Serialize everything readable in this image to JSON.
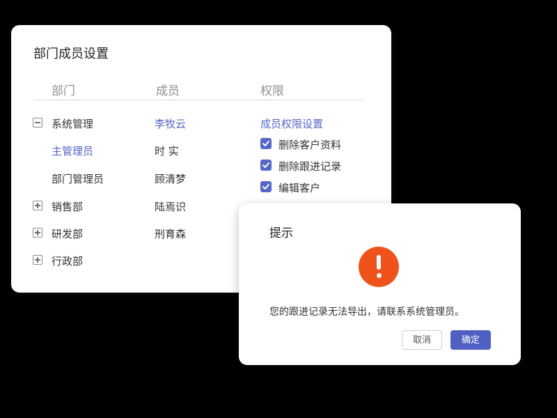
{
  "card": {
    "title": "部门成员设置",
    "columns": {
      "dept": "部门",
      "member": "成员",
      "permission": "权限"
    },
    "departments": [
      {
        "label": "系统管理",
        "toggle": "collapse"
      },
      {
        "label": "主管理员",
        "toggle": "none",
        "selected": true
      },
      {
        "label": "部门管理员",
        "toggle": "none"
      },
      {
        "label": "销售部",
        "toggle": "expand"
      },
      {
        "label": "研发部",
        "toggle": "expand"
      },
      {
        "label": "行政部",
        "toggle": "expand"
      }
    ],
    "members": [
      "李牧云",
      "时 实",
      "顾清梦",
      "陆焉识",
      "刑育森"
    ],
    "permission_header": "成员权限设置",
    "permissions": [
      {
        "label": "删除客户资料",
        "checked": true
      },
      {
        "label": "删除跟进记录",
        "checked": true
      },
      {
        "label": "编辑客户",
        "checked": true
      }
    ]
  },
  "dialog": {
    "title": "提示",
    "icon": "warning-icon",
    "message": "您的跟进记录无法导出，请联系系统管理员。",
    "cancel_label": "取消",
    "ok_label": "确定"
  },
  "colors": {
    "accent": "#5566c8",
    "primary_button": "#4f5fc4",
    "warning": "#f0521c",
    "background": "#000000"
  }
}
